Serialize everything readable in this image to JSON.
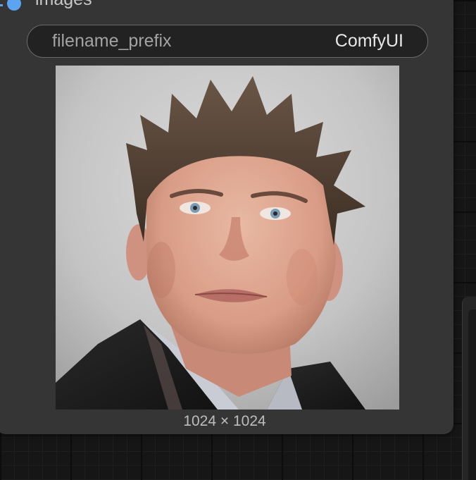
{
  "node": {
    "input": {
      "name": "images",
      "color": "#5ca4f0"
    },
    "widget": {
      "label": "filename_prefix",
      "value": "ComfyUI"
    },
    "preview": {
      "subject": "portrait-photo",
      "dimensions": "1024 × 1024"
    }
  },
  "colors": {
    "node_body": "#353535",
    "canvas": "#161616",
    "widget_bg": "#222222"
  }
}
